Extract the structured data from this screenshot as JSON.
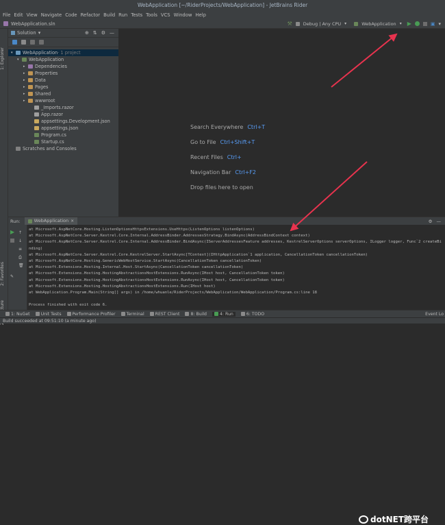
{
  "window": {
    "title": "WebApplication [~/RiderProjects/WebApplication] - JetBrains Rider"
  },
  "menu": [
    "File",
    "Edit",
    "View",
    "Navigate",
    "Code",
    "Refactor",
    "Build",
    "Run",
    "Tests",
    "Tools",
    "VCS",
    "Window",
    "Help"
  ],
  "navbar": {
    "breadcrumb": "WebApplication.sln",
    "config": "Debug | Any CPU",
    "run_target": "WebApplication"
  },
  "left_strip": {
    "tab1": "1: Explorer",
    "tab2": "2: Favorites",
    "tab3": "Z: Structure"
  },
  "solution": {
    "header": "Solution",
    "tree": [
      {
        "label": "WebApplication",
        "suffix": " · 1 project",
        "indent": 0,
        "icon_color": "#6897bb"
      },
      {
        "label": "WebApplication",
        "suffix": "",
        "indent": 1,
        "icon_color": "#6a8759"
      },
      {
        "label": "Dependencies",
        "suffix": "",
        "indent": 2,
        "icon_color": "#9876aa"
      },
      {
        "label": "Properties",
        "suffix": "",
        "indent": 2,
        "icon_color": "#c09553"
      },
      {
        "label": "Data",
        "suffix": "",
        "indent": 2,
        "icon_color": "#c09553"
      },
      {
        "label": "Pages",
        "suffix": "",
        "indent": 2,
        "icon_color": "#c09553"
      },
      {
        "label": "Shared",
        "suffix": "",
        "indent": 2,
        "icon_color": "#c09553"
      },
      {
        "label": "wwwroot",
        "suffix": "",
        "indent": 2,
        "icon_color": "#c09553"
      },
      {
        "label": "_Imports.razor",
        "suffix": "",
        "indent": 3,
        "icon_color": "#9e9e9e"
      },
      {
        "label": "App.razor",
        "suffix": "",
        "indent": 3,
        "icon_color": "#9e9e9e"
      },
      {
        "label": "appsettings.Development.json",
        "suffix": "",
        "indent": 3,
        "icon_color": "#c9a95f"
      },
      {
        "label": "appsettings.json",
        "suffix": "",
        "indent": 3,
        "icon_color": "#c9a95f"
      },
      {
        "label": "Program.cs",
        "suffix": "",
        "indent": 3,
        "icon_color": "#6a8759"
      },
      {
        "label": "Startup.cs",
        "suffix": "",
        "indent": 3,
        "icon_color": "#6a8759"
      },
      {
        "label": "Scratches and Consoles",
        "suffix": "",
        "indent": 0,
        "icon_color": "#808080"
      }
    ]
  },
  "editor_hints": [
    {
      "text": "Search Everywhere",
      "key": "Ctrl+T"
    },
    {
      "text": "Go to File",
      "key": "Ctrl+Shift+T"
    },
    {
      "text": "Recent Files",
      "key": "Ctrl+"
    },
    {
      "text": "Navigation Bar",
      "key": "Ctrl+F2"
    },
    {
      "text": "Drop files here to open",
      "key": ""
    }
  ],
  "run_panel": {
    "label": "Run:",
    "tab": "WebApplication",
    "lines": [
      "   at Microsoft.AspNetCore.Hosting.ListenOptionsHttpsExtensions.UseHttps(ListenOptions listenOptions)",
      "   at Microsoft.AspNetCore.Server.Kestrel.Core.Internal.AddressBinder.AddressesStrategy.BindAsync(AddressBindContext context)",
      "   at Microsoft.AspNetCore.Server.Kestrel.Core.Internal.AddressBinder.BindAsync(IServerAddressesFeature addresses, KestrelServerOptions serverOptions, ILogger logger, Func`2 createBi",
      "nding)",
      "   at Microsoft.AspNetCore.Server.Kestrel.Core.KestrelServer.StartAsync[TContext](IHttpApplication`1 application, CancellationToken cancellationToken)",
      "   at Microsoft.AspNetCore.Hosting.GenericWebHostService.StartAsync(CancellationToken cancellationToken)",
      "   at Microsoft.Extensions.Hosting.Internal.Host.StartAsync(CancellationToken cancellationToken)",
      "   at Microsoft.Extensions.Hosting.HostingAbstractionsHostExtensions.RunAsync(IHost host, CancellationToken token)",
      "   at Microsoft.Extensions.Hosting.HostingAbstractionsHostExtensions.RunAsync(IHost host, CancellationToken token)",
      "   at Microsoft.Extensions.Hosting.HostingAbstractionsHostExtensions.Run(IHost host)",
      "   at WebApplication.Program.Main(String[] args) in /home/whuanle/RiderProjects/WebApplication/WebApplication/Program.cs:line 18",
      "",
      "Process finished with exit code 6."
    ]
  },
  "bottom_tabs": [
    {
      "label": "1: NuGet"
    },
    {
      "label": "Unit Tests"
    },
    {
      "label": "Performance Profiler"
    },
    {
      "label": "Terminal"
    },
    {
      "label": "REST Client"
    },
    {
      "label": "8: Build"
    },
    {
      "label": "4: Run"
    },
    {
      "label": "6: TODO"
    }
  ],
  "event_log": "Event Lo",
  "status": "Build succeeded at 09:51:10 (a minute ago)",
  "watermark": "dotNET跨平台",
  "colors": {
    "arrow": "#e8334e",
    "run_green": "#499c54",
    "accent_blue": "#589df6"
  }
}
